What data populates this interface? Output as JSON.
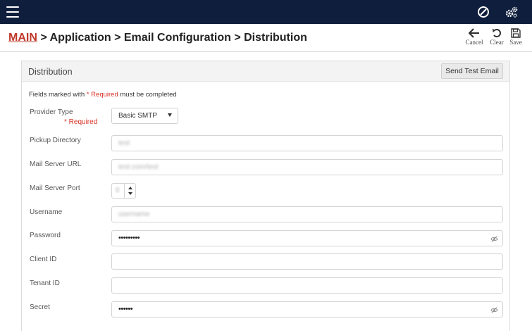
{
  "topbar": {
    "menu_icon": "hamburger-menu-icon",
    "icons": [
      "compass-icon",
      "gears-icon"
    ],
    "background": "#0f1e3c"
  },
  "breadcrumb": {
    "main": "MAIN",
    "rest": " > Application > Email Configuration > Distribution"
  },
  "actions": {
    "cancel": "Cancel",
    "clear": "Clear",
    "save": "Save"
  },
  "panel": {
    "title": "Distribution",
    "send_test_label": "Send Test Email"
  },
  "required_note": {
    "prefix": "Fields marked with ",
    "marker": "* Required",
    "suffix": " must be completed"
  },
  "form": {
    "provider_type": {
      "label": "Provider Type",
      "required": "* Required",
      "value": "Basic SMTP"
    },
    "pickup_directory": {
      "label": "Pickup Directory",
      "value": "test"
    },
    "mail_server_url": {
      "label": "Mail Server URL",
      "value": "test.com/test"
    },
    "mail_server_port": {
      "label": "Mail Server Port",
      "value": "0"
    },
    "username": {
      "label": "Username",
      "value": "username"
    },
    "password": {
      "label": "Password",
      "value": "•••••••••"
    },
    "client_id": {
      "label": "Client ID",
      "value": ""
    },
    "tenant_id": {
      "label": "Tenant ID",
      "value": ""
    },
    "secret": {
      "label": "Secret",
      "value": "••••••"
    }
  },
  "colors": {
    "accent_red": "#c0392b",
    "required_red": "#d93025"
  }
}
